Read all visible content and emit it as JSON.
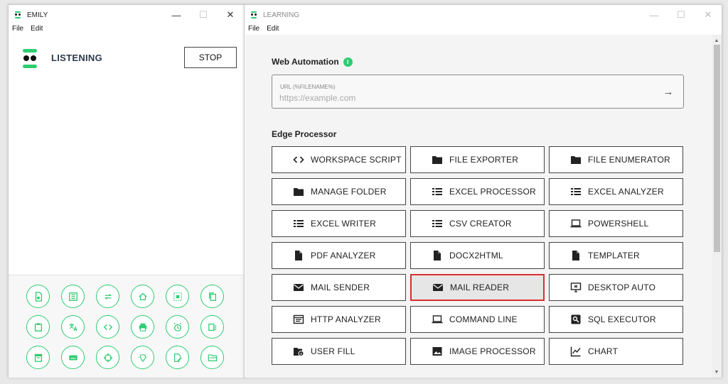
{
  "emily": {
    "title": "EMILY",
    "menu": [
      "File",
      "Edit"
    ],
    "status": "LISTENING",
    "stop_label": "STOP",
    "tray_icons": [
      "file-icon",
      "list-icon",
      "repeat-icon",
      "home-icon",
      "target-select-icon",
      "copy-icon",
      "clipboard-icon",
      "translate-icon",
      "code-icon",
      "print-icon",
      "alarm-icon",
      "list-check-icon",
      "archive-icon",
      "keyboard-icon",
      "crosshair-icon",
      "lightbulb-icon",
      "edit-file-icon",
      "folder-open-icon"
    ]
  },
  "learning": {
    "title": "LEARNING",
    "menu": [
      "File",
      "Edit"
    ],
    "web_automation_title": "Web Automation",
    "url_label": "URL (%FILENAME%)",
    "url_placeholder": "https://example.com",
    "edge_processor_title": "Edge Processor",
    "tiles": [
      {
        "label": "WORKSPACE SCRIPT",
        "icon": "code-icon"
      },
      {
        "label": "FILE EXPORTER",
        "icon": "folder-icon"
      },
      {
        "label": "FILE ENUMERATOR",
        "icon": "folder-icon"
      },
      {
        "label": "MANAGE FOLDER",
        "icon": "folder-icon"
      },
      {
        "label": "EXCEL PROCESSOR",
        "icon": "list-icon"
      },
      {
        "label": "EXCEL ANALYZER",
        "icon": "list-icon"
      },
      {
        "label": "EXCEL WRITER",
        "icon": "list-icon"
      },
      {
        "label": "CSV CREATOR",
        "icon": "list-icon"
      },
      {
        "label": "POWERSHELL",
        "icon": "laptop-icon"
      },
      {
        "label": "PDF ANALYZER",
        "icon": "document-icon"
      },
      {
        "label": "DOCX2HTML",
        "icon": "document-icon"
      },
      {
        "label": "TEMPLATER",
        "icon": "document-icon"
      },
      {
        "label": "MAIL SENDER",
        "icon": "mail-icon"
      },
      {
        "label": "MAIL READER",
        "icon": "mail-icon",
        "selected": true
      },
      {
        "label": "DESKTOP AUTO",
        "icon": "monitor-icon"
      },
      {
        "label": "HTTP ANALYZER",
        "icon": "browser-window-icon"
      },
      {
        "label": "COMMAND LINE",
        "icon": "laptop-icon"
      },
      {
        "label": "SQL EXECUTOR",
        "icon": "search-box-icon"
      },
      {
        "label": "USER FILL",
        "icon": "folder-info-icon"
      },
      {
        "label": "IMAGE PROCESSOR",
        "icon": "image-icon"
      },
      {
        "label": "CHART",
        "icon": "line-chart-icon"
      }
    ]
  },
  "colors": {
    "accent": "#2ecc71",
    "selected_border": "#d9302e"
  }
}
